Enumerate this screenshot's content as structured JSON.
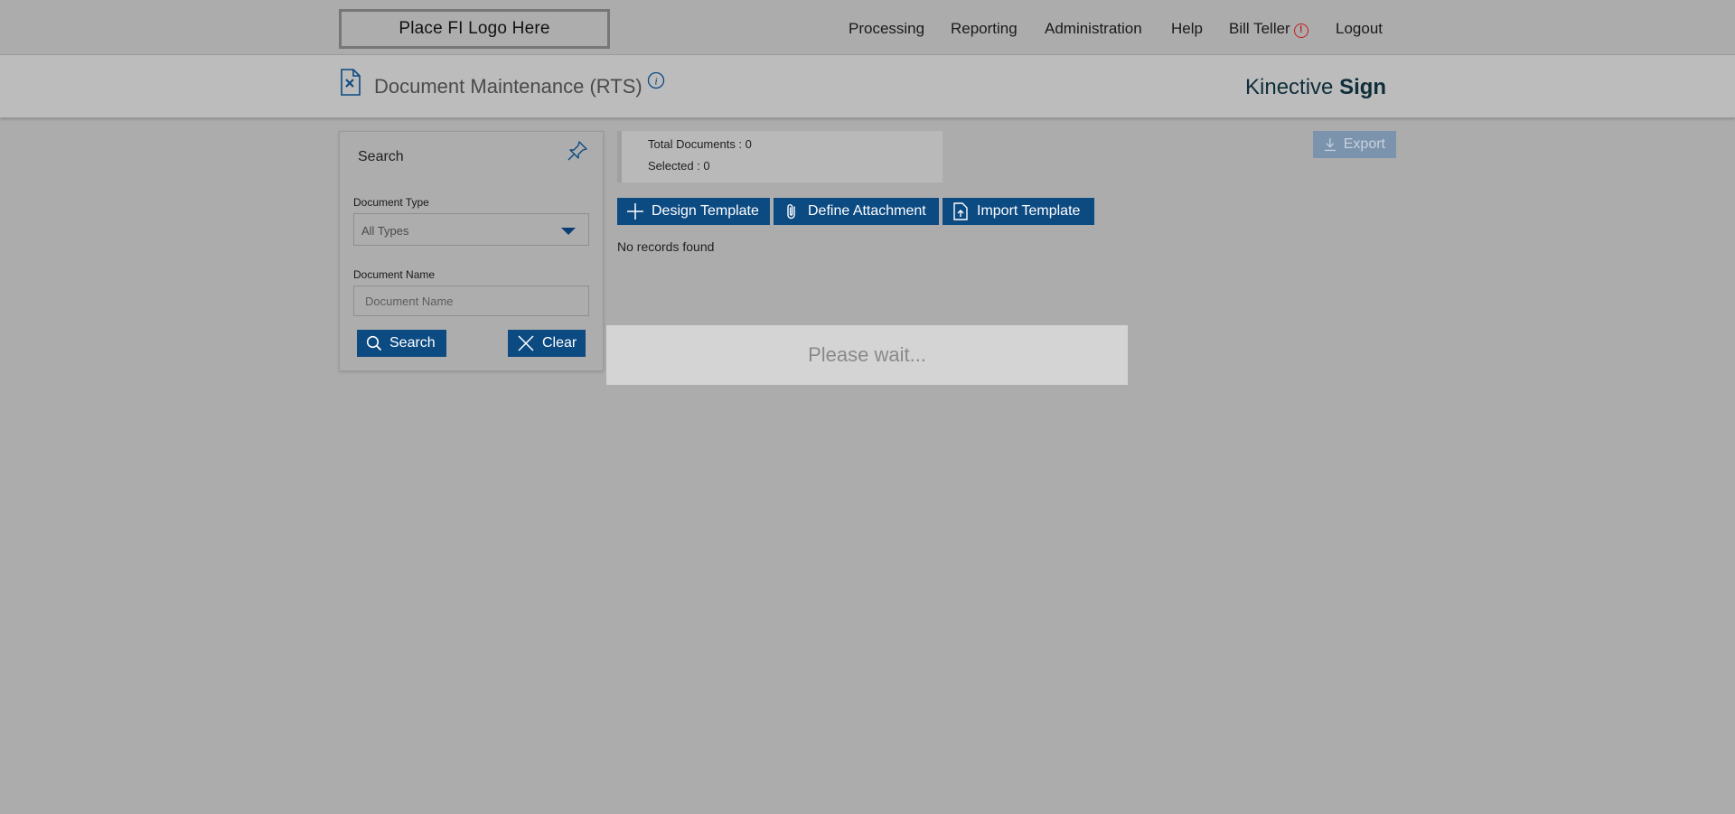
{
  "header": {
    "logo_text": "Place FI Logo Here",
    "nav": {
      "processing": "Processing",
      "reporting": "Reporting",
      "administration": "Administration",
      "help": "Help",
      "user": "Bill Teller",
      "logout": "Logout"
    },
    "user_alert_glyph": "!"
  },
  "title_band": {
    "page_title": "Document Maintenance (RTS)",
    "brand_prefix": "Kinective",
    "brand_bold": "Sign",
    "info_glyph": "i"
  },
  "search_panel": {
    "title": "Search",
    "document_type_label": "Document Type",
    "document_type_value": "All Types",
    "document_name_label": "Document Name",
    "document_name_placeholder": "Document Name",
    "search_button": "Search",
    "clear_button": "Clear"
  },
  "content": {
    "total_documents": "Total Documents : 0",
    "selected": "Selected : 0",
    "export_button": "Export",
    "actions": {
      "design_template": "Design Template",
      "define_attachment": "Define Attachment",
      "import_template": "Import Template"
    },
    "no_records": "No records found"
  },
  "overlay": {
    "message": "Please wait..."
  },
  "colors": {
    "primary_button": "#0c4a82",
    "alert": "#c41a1a",
    "background": "#acacac"
  }
}
